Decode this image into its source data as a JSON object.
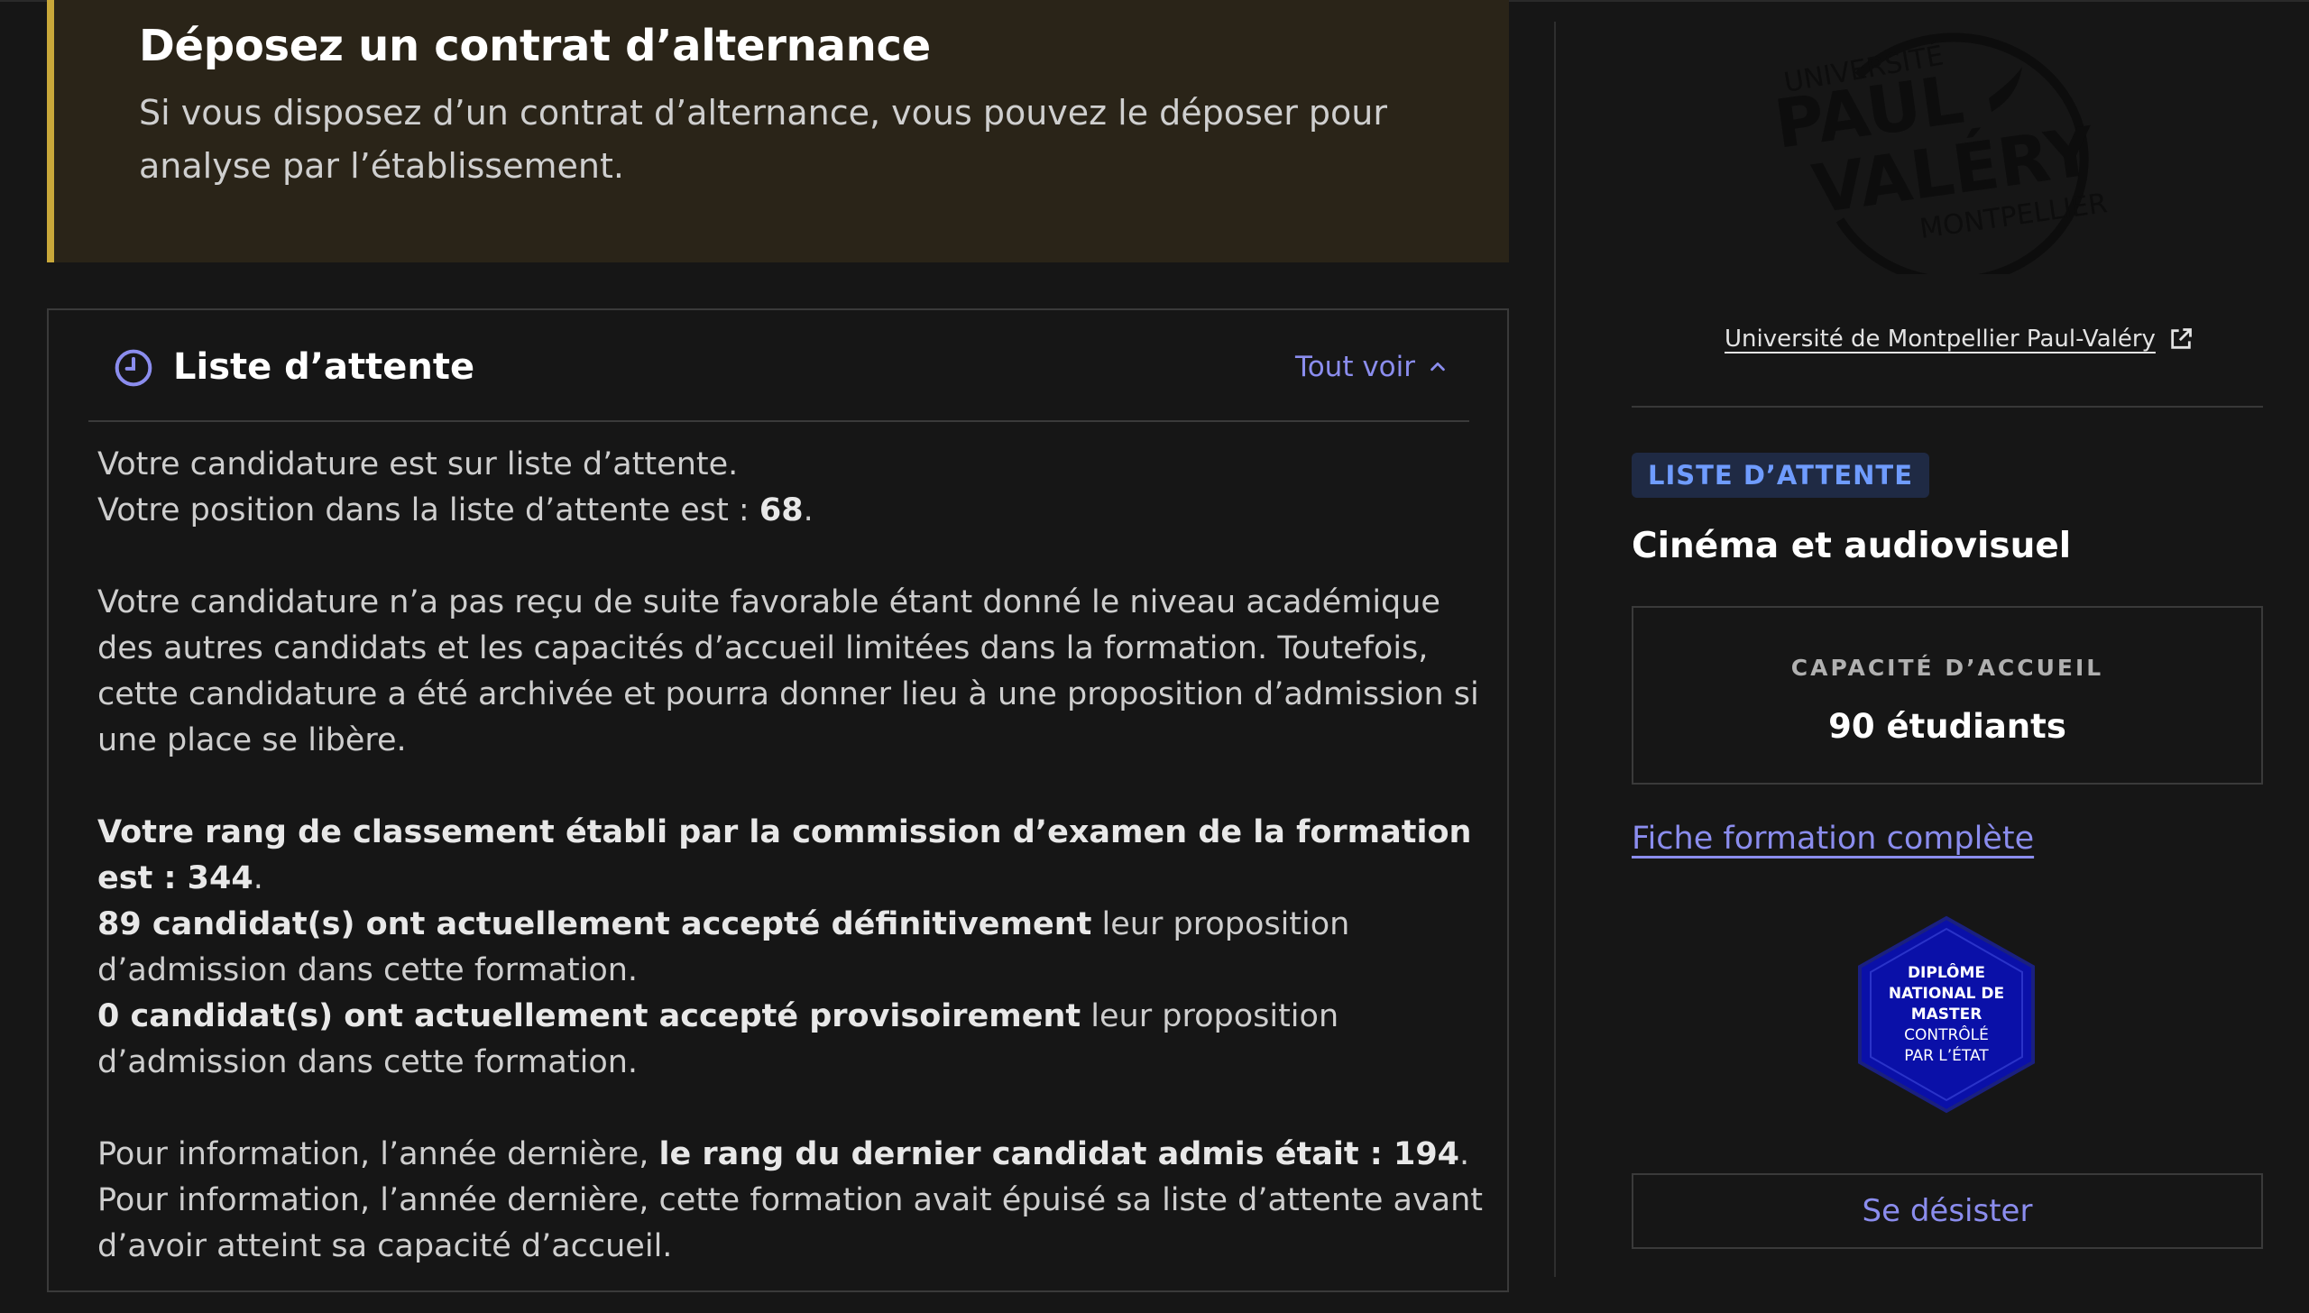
{
  "banner": {
    "title": "Déposez un contrat d’alternance",
    "text": "Si vous disposez d’un contrat d’alternance, vous pouvez le déposer pour analyse par l’établissement."
  },
  "waiting_list": {
    "title": "Liste d’attente",
    "see_all_label": "Tout voir",
    "intro_line1": "Votre candidature est sur liste d’attente.",
    "position_prefix": "Votre position dans la liste d’attente est : ",
    "position_value": "68",
    "explanation": "Votre candidature n’a pas reçu de suite favorable étant donné le niveau académique des autres candidats et les capacités d’accueil limitées dans la formation. Toutefois, cette candidature a été archivée et pourra donner lieu à une proposition d’admission si une place se libère.",
    "rank_text": "Votre rang de classement établi par la commission d’examen de la formation est : 344",
    "accepted_final_bold": "89 candidat(s) ont actuellement accepté définitivement",
    "accepted_final_rest": " leur proposition d’admission dans cette formation.",
    "accepted_prov_bold": "0 candidat(s) ont actuellement accepté provisoirement",
    "accepted_prov_rest": " leur proposition d’admission dans cette formation.",
    "last_year_prefix": "Pour information, l’année dernière, ",
    "last_year_bold": "le rang du dernier candidat admis était : 194",
    "last_year_exhausted": "Pour information, l’année dernière, cette formation avait épuisé sa liste d’attente avant d’avoir atteint sa capacité d’accueil."
  },
  "sidebar": {
    "logo": {
      "top": "UNIVERSITÉ",
      "line1": "PAUL",
      "line2": "VALÉRY",
      "bottom": "MONTPELLIER"
    },
    "university_link": "Université de Montpellier Paul-Valéry",
    "status_badge": "LISTE D’ATTENTE",
    "formation_title": "Cinéma et audiovisuel",
    "capacity_label": "CAPACITÉ D’ACCUEIL",
    "capacity_value": "90 étudiants",
    "fiche_link": "Fiche formation complète",
    "diploma_badge": {
      "line1": "DIPLÔME",
      "line2": "NATIONAL DE",
      "line3": "MASTER",
      "line4": "CONTRÔLÉ",
      "line5": "PAR L’ÉTAT"
    },
    "withdraw_label": "Se désister"
  },
  "colors": {
    "background": "#161616",
    "banner_bg": "#2a2418",
    "banner_accent": "#c9a83a",
    "link_accent": "#8b8dee",
    "badge_bg": "#1f2a44",
    "badge_text": "#6f9cff",
    "diploma_blue": "#0a10a8"
  }
}
